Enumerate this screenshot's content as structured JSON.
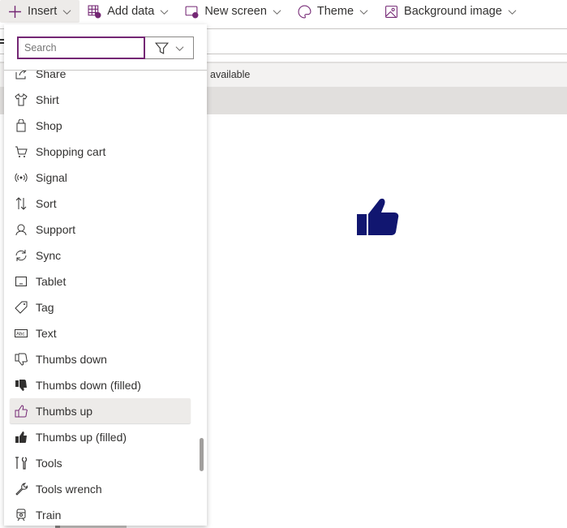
{
  "toolbar": {
    "insert": "Insert",
    "add_data": "Add data",
    "new_screen": "New screen",
    "theme": "Theme",
    "background_image": "Background image"
  },
  "canvas": {
    "status_text": "available",
    "icon_color": "#111670"
  },
  "panel": {
    "search_placeholder": "Search",
    "items": [
      {
        "label": "Share",
        "icon": "share-icon"
      },
      {
        "label": "Shirt",
        "icon": "shirt-icon"
      },
      {
        "label": "Shop",
        "icon": "shop-icon"
      },
      {
        "label": "Shopping cart",
        "icon": "shopping-cart-icon"
      },
      {
        "label": "Signal",
        "icon": "signal-icon"
      },
      {
        "label": "Sort",
        "icon": "sort-icon"
      },
      {
        "label": "Support",
        "icon": "support-icon"
      },
      {
        "label": "Sync",
        "icon": "sync-icon"
      },
      {
        "label": "Tablet",
        "icon": "tablet-icon"
      },
      {
        "label": "Tag",
        "icon": "tag-icon"
      },
      {
        "label": "Text",
        "icon": "text-icon"
      },
      {
        "label": "Thumbs down",
        "icon": "thumbs-down-icon"
      },
      {
        "label": "Thumbs down (filled)",
        "icon": "thumbs-down-filled-icon"
      },
      {
        "label": "Thumbs up",
        "icon": "thumbs-up-icon",
        "selected": true
      },
      {
        "label": "Thumbs up (filled)",
        "icon": "thumbs-up-filled-icon"
      },
      {
        "label": "Tools",
        "icon": "tools-icon"
      },
      {
        "label": "Tools wrench",
        "icon": "wrench-icon"
      },
      {
        "label": "Train",
        "icon": "train-icon"
      }
    ]
  },
  "colors": {
    "accent": "#742774"
  }
}
